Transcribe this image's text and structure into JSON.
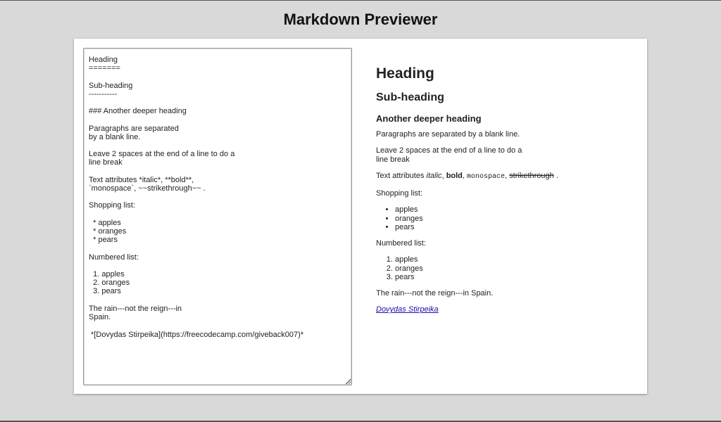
{
  "app": {
    "title": "Markdown Previewer"
  },
  "editor": {
    "content": "Heading\n=======\n\nSub-heading\n-----------\n\n### Another deeper heading\n\nParagraphs are separated\nby a blank line.\n\nLeave 2 spaces at the end of a line to do a\nline break\n\nText attributes *italic*, **bold**,\n`monospace`, ~~strikethrough~~ .\n\nShopping list:\n\n  * apples\n  * oranges\n  * pears\n\nNumbered list:\n\n  1. apples\n  2. oranges\n  3. pears\n\nThe rain---not the reign---in\nSpain.\n\n *[Dovydas Stirpeika](https://freecodecamp.com/giveback007)*"
  },
  "preview": {
    "h1": "Heading",
    "h2": "Sub-heading",
    "h3": "Another deeper heading",
    "p1": "Paragraphs are separated by a blank line.",
    "p2_line1": "Leave 2 spaces at the end of a line to do a",
    "p2_line2": "line break",
    "attrs": {
      "prefix": "Text attributes ",
      "italic": "italic",
      "sep1": ", ",
      "bold": "bold",
      "sep2": ", ",
      "monospace": "monospace",
      "sep3": ", ",
      "strike": "strikethrough",
      "suffix": " ."
    },
    "shopping_label": "Shopping list:",
    "shopping_items": [
      "apples",
      "oranges",
      "pears"
    ],
    "numbered_label": "Numbered list:",
    "numbered_items": [
      "apples",
      "oranges",
      "pears"
    ],
    "rain": "The rain---not the reign---in Spain.",
    "link_text": "Dovydas Stirpeika"
  }
}
